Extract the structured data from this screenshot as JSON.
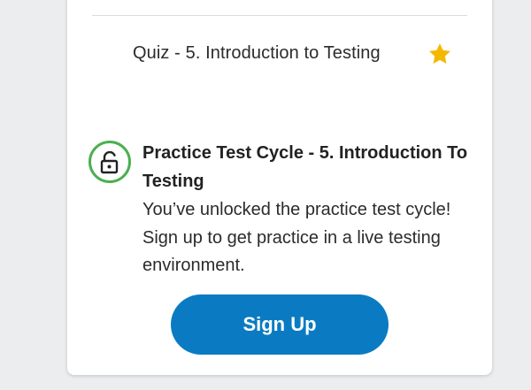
{
  "quiz": {
    "label": "Quiz - 5. Introduction to Testing",
    "star_icon": "star-icon",
    "star_color": "#F5B800"
  },
  "practice": {
    "lock_icon": "unlocked-padlock-icon",
    "badge_color": "#4CAF50",
    "title": "Practice Test Cycle - 5. Introduction To Testing",
    "description": "You’ve unlocked the practice test cycle! Sign up to get practice in a live testing environment."
  },
  "cta": {
    "label": "Sign Up",
    "color": "#0A7BC2"
  }
}
